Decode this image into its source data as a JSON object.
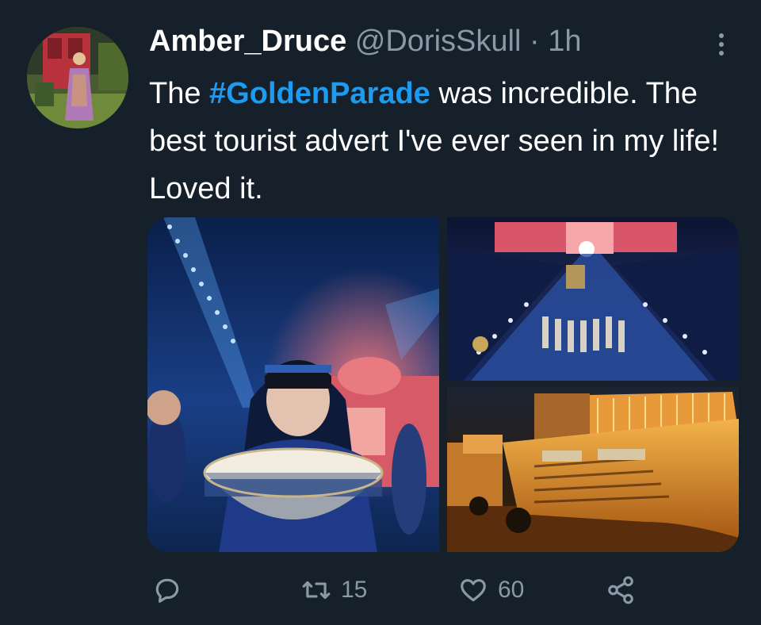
{
  "tweet": {
    "display_name": "Amber_Druce",
    "handle": "@DorisSkull",
    "separator": "·",
    "time": "1h",
    "text_before": "The ",
    "hashtag": "#GoldenParade",
    "text_after": " was incredible. The best tourist advert I've ever seen in my life! Loved it.",
    "more_icon": "more-vertical-icon"
  },
  "media": [
    {
      "name": "performer-with-bowl-photo"
    },
    {
      "name": "parade-avenue-night-photo"
    },
    {
      "name": "golden-royal-carriage-photo"
    }
  ],
  "actions": {
    "reply_icon": "reply-icon",
    "reply_count": "",
    "retweet_icon": "retweet-icon",
    "retweet_count": "15",
    "like_icon": "heart-icon",
    "like_count": "60",
    "share_icon": "share-icon"
  },
  "colors": {
    "background": "#15202b",
    "text": "#ffffff",
    "secondary": "#8b98a5",
    "accent": "#1d9bf0"
  }
}
